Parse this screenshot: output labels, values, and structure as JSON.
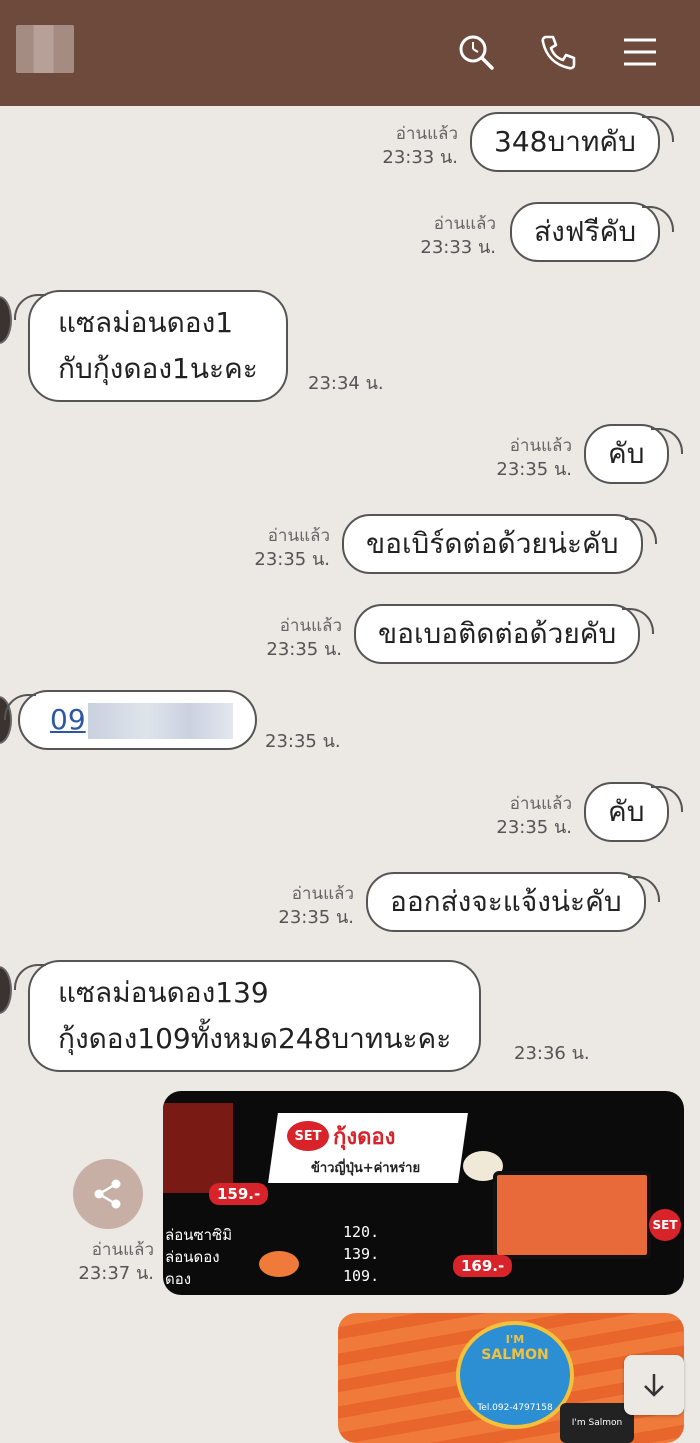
{
  "messages": [
    {
      "dir": "out",
      "text": "348บาทคับ",
      "read": "อ่านแล้ว",
      "time": "23:33 น."
    },
    {
      "dir": "out",
      "text": "ส่งฟรีคับ",
      "read": "อ่านแล้ว",
      "time": "23:33 น."
    },
    {
      "dir": "in",
      "line1": "แซลม่อนดอง1",
      "line2": "กับกุ้งดอง1นะคะ",
      "time": "23:34 น."
    },
    {
      "dir": "out",
      "text": "คับ",
      "read": "อ่านแล้ว",
      "time": "23:35 น."
    },
    {
      "dir": "out",
      "text": "ขอเบิร์ดต่อด้วยน่ะคับ",
      "read": "อ่านแล้ว",
      "time": "23:35 น."
    },
    {
      "dir": "out",
      "text": "ขอเบอติดต่อด้วยคับ",
      "read": "อ่านแล้ว",
      "time": "23:35 น."
    },
    {
      "dir": "in",
      "phone_prefix": "09",
      "time": "23:35 น."
    },
    {
      "dir": "out",
      "text": "คับ",
      "read": "อ่านแล้ว",
      "time": "23:35 น."
    },
    {
      "dir": "out",
      "text": "ออกส่งจะแจ้งน่ะคับ",
      "read": "อ่านแล้ว",
      "time": "23:35 น."
    },
    {
      "dir": "in",
      "line1": "แซลม่อนดอง139",
      "line2": "กุ้งดอง109ทั้งหมด248บาทนะคะ",
      "time": "23:36 น."
    },
    {
      "dir": "out",
      "type": "image",
      "read": "อ่านแล้ว",
      "time": "23:37 น."
    }
  ],
  "image1": {
    "set_label": "SET",
    "title": "กุ้งดอง",
    "subtitle": "ข้าวญี่ปุ่น+ค่าหร่าย",
    "price_left": "159.-",
    "price_right": "169.-",
    "set_right": "SET",
    "menu": [
      {
        "name": "ล่อนซาซิมิ",
        "price": "120."
      },
      {
        "name": "ล่อนดอง",
        "price": "139."
      },
      {
        "name": "ดอง",
        "price": "109."
      }
    ]
  },
  "image2": {
    "logo_line1": "I'M",
    "logo_line2": "SALMON",
    "tel": "Tel.092-4797158",
    "tag": "I'm Salmon"
  },
  "icons": [
    "search-icon",
    "phone-icon",
    "menu-icon",
    "share-icon",
    "scroll-down-icon"
  ],
  "colors": {
    "header": "#6d4a3b",
    "background": "#ece8e3",
    "link": "#2c57a8"
  }
}
